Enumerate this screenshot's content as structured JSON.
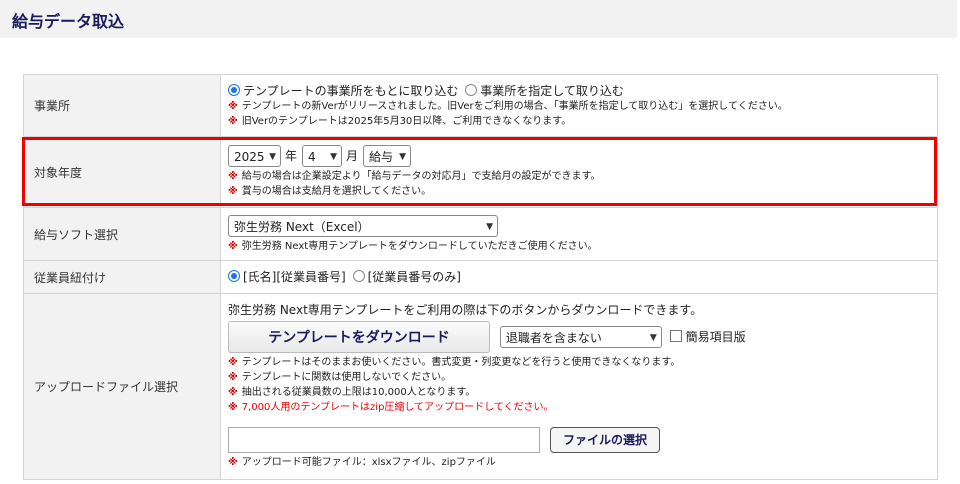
{
  "page": {
    "title": "給与データ取込"
  },
  "office": {
    "label": "事業所",
    "option1": "テンプレートの事業所をもとに取り込む",
    "option2": "事業所を指定して取り込む",
    "notes": [
      "テンプレートの新Verがリリースされました。旧Verをご利用の場合、「事業所を指定して取り込む」を選択してください。",
      "旧Verのテンプレートは2025年5月30日以降、ご利用できなくなります。"
    ]
  },
  "target_year": {
    "label": "対象年度",
    "year": "2025",
    "year_unit": "年",
    "month": "4",
    "month_unit": "月",
    "type": "給与",
    "notes": [
      "給与の場合は企業設定より「給与データの対応月」で支給月の設定ができます。",
      "賞与の場合は支給月を選択してください。"
    ]
  },
  "software": {
    "label": "給与ソフト選択",
    "selected": "弥生労務 Next（Excel）",
    "note": "弥生労務 Next専用テンプレートをダウンロードしていただきご使用ください。"
  },
  "employee_link": {
    "label": "従業員紐付け",
    "option1": "[氏名][従業員番号]",
    "option2": "[従業員番号のみ]"
  },
  "upload": {
    "label": "アップロードファイル選択",
    "intro": "弥生労務 Next専用テンプレートをご利用の際は下のボタンからダウンロードできます。",
    "download_button": "テンプレートをダウンロード",
    "retiree_select": "退職者を含まない",
    "simple_checkbox": "簡易項目版",
    "notes": [
      "テンプレートはそのままお使いください。書式変更・列変更などを行うと使用できなくなります。",
      "テンプレートに関数は使用しないでください。",
      "抽出される従業員数の上限は10,000人となります。"
    ],
    "red_note": "7,000人用のテンプレートはzip圧縮してアップロードしてください。",
    "file_button": "ファイルの選択",
    "file_note": "アップロード可能ファイル：xlsxファイル、zipファイル"
  },
  "note_mark": "※",
  "colors": {
    "accent": "#1a1a5e",
    "highlight": "#ee0000",
    "note_mark": "#dd0000"
  }
}
